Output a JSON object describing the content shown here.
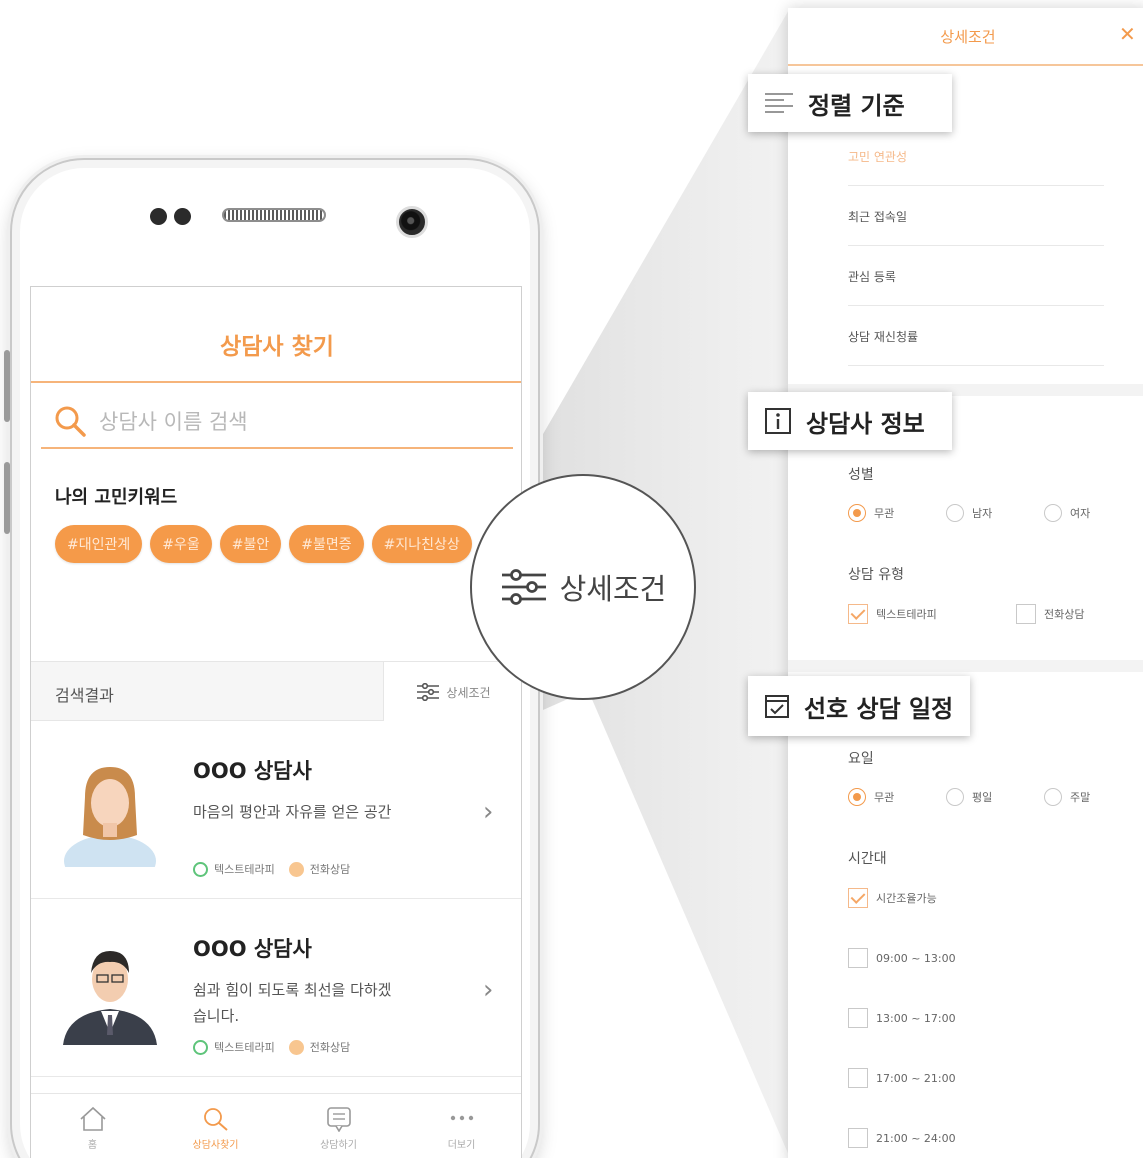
{
  "app": {
    "title": "상담사 찾기",
    "search_placeholder": "상담사 이름 검색",
    "keywords_title": "나의 고민키워드",
    "keywords": [
      "#대인관계",
      "#우울",
      "#불안",
      "#불면증",
      "#지나친상상"
    ],
    "results_label": "검색결과",
    "filter_button": "상세조건",
    "counselors": [
      {
        "name": "OOO 상담사",
        "desc": "마음의 평안과 자유를 얻은 공간",
        "tags": [
          "텍스트테라피",
          "전화상담"
        ]
      },
      {
        "name": "OOO 상담사",
        "desc": "쉼과 힘이 되도록 최선을 다하겠습니다.",
        "tags": [
          "텍스트테라피",
          "전화상담"
        ]
      }
    ],
    "tabbar": [
      {
        "label": "홈",
        "icon": "home-icon"
      },
      {
        "label": "상담사찾기",
        "icon": "search-icon"
      },
      {
        "label": "상담하기",
        "icon": "chat-icon"
      },
      {
        "label": "더보기",
        "icon": "more-icon"
      }
    ],
    "active_tab": 1
  },
  "magnifier": {
    "label": "상세조건",
    "icon": "filter-sliders-icon"
  },
  "panel": {
    "title": "상세조건",
    "close": "✕",
    "sort": {
      "heading": "정렬 기준",
      "options": [
        "고민 연관성",
        "최근 접속일",
        "관심 등록",
        "상담 재신청률"
      ],
      "selected": 0
    },
    "info": {
      "heading": "상담사 정보",
      "gender_label": "성별",
      "gender_options": [
        "무관",
        "남자",
        "여자"
      ],
      "gender_selected": 0,
      "type_label": "상담 유형",
      "type_options": [
        {
          "label": "텍스트테라피",
          "checked": true
        },
        {
          "label": "전화상담",
          "checked": false
        }
      ]
    },
    "schedule": {
      "heading": "선호 상담 일정",
      "day_label": "요일",
      "day_options": [
        "무관",
        "평일",
        "주말"
      ],
      "day_selected": 0,
      "time_label": "시간대",
      "time_options": [
        {
          "label": "시간조율가능",
          "checked": true
        },
        {
          "label": "09:00 ~ 13:00",
          "checked": false
        },
        {
          "label": "13:00 ~ 17:00",
          "checked": false
        },
        {
          "label": "17:00 ~ 21:00",
          "checked": false
        },
        {
          "label": "21:00 ~ 24:00",
          "checked": false
        }
      ]
    }
  },
  "colors": {
    "accent": "#f39a4c",
    "chip": "#f59a49",
    "chip_text": "#ffe8d4"
  }
}
